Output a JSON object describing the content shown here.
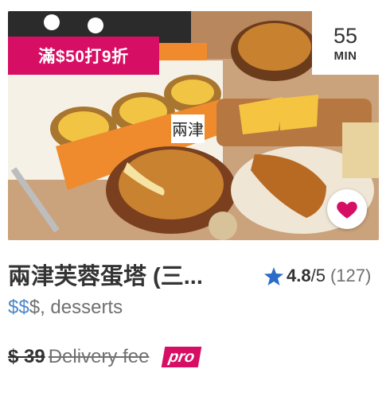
{
  "restaurant": {
    "name": "兩津芙蓉蛋塔 (三...",
    "image_alt": "Egg tarts, pineapple bun and croissant"
  },
  "promo": {
    "label": "滿$50打9折",
    "color": "#d70f64"
  },
  "eta": {
    "value": "55",
    "unit": "MIN"
  },
  "rating": {
    "score": "4.8",
    "out_of": "/5",
    "count": "(127)",
    "star_color": "#2a6cc7"
  },
  "price_level": {
    "active": "$$",
    "inactive": "$",
    "active_color": "#4a86c8"
  },
  "category": ", desserts",
  "delivery": {
    "fee": "$ 39",
    "label": "Delivery fee",
    "pro_label": "pro"
  },
  "favorite": {
    "icon": "heart-icon",
    "color": "#d70f64"
  },
  "store_sign": "兩津"
}
